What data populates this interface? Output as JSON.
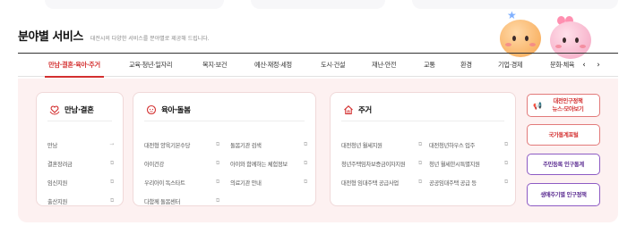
{
  "section": {
    "title": "분야별 서비스",
    "description": "대전시의 다양한 서비스를 분야별로 제공해 드립니다."
  },
  "tabs": [
    {
      "label": "만남·결혼·육아·주거",
      "active": true
    },
    {
      "label": "교육·청년·일자리"
    },
    {
      "label": "복지·보건"
    },
    {
      "label": "예산·재정·세정"
    },
    {
      "label": "도시·건설"
    },
    {
      "label": "재난·안전"
    },
    {
      "label": "교통"
    },
    {
      "label": "환경"
    },
    {
      "label": "기업·경제"
    },
    {
      "label": "문화·체육"
    }
  ],
  "nav": {
    "prev": "‹",
    "next": "›"
  },
  "cards": {
    "marriage": {
      "title": "만남·결혼",
      "icon": "heart-hands-icon",
      "links": [
        "만남",
        "결혼장려금",
        "임신지원",
        "출산지원"
      ]
    },
    "childcare": {
      "title": "육아·돌봄",
      "icon": "baby-icon",
      "links_left": [
        "대전형 양육기본수당",
        "아이건강",
        "우리아이 독스타트",
        "다함께 돌봄센터"
      ],
      "links_right": [
        "돌봄기관 검색",
        "아이와 함께하는 체험정보",
        "의료기관 안내"
      ]
    },
    "housing": {
      "title": "주거",
      "icon": "house-icon",
      "links_left": [
        "대전청년 월세지원",
        "청년주택임차보증금이자지원",
        "대전형 임대주택 공급사업"
      ],
      "links_right": [
        "대전청년하우스 입주",
        "청년 월세한시특별지원",
        "공공임대주택 공급 등"
      ]
    }
  },
  "side_buttons": [
    {
      "label_line1": "대전인구정책",
      "label_line2": "뉴스·모아보기",
      "icon": "megaphone-icon"
    },
    {
      "label_line1": "국가통계포털"
    },
    {
      "label_line1": "주민등록 인구통계"
    },
    {
      "label_line1": "생애주기별 인구정책"
    }
  ],
  "colors": {
    "accent": "#d32f2f",
    "panel": "#fdf1f1",
    "purple": "#5b2c91"
  }
}
